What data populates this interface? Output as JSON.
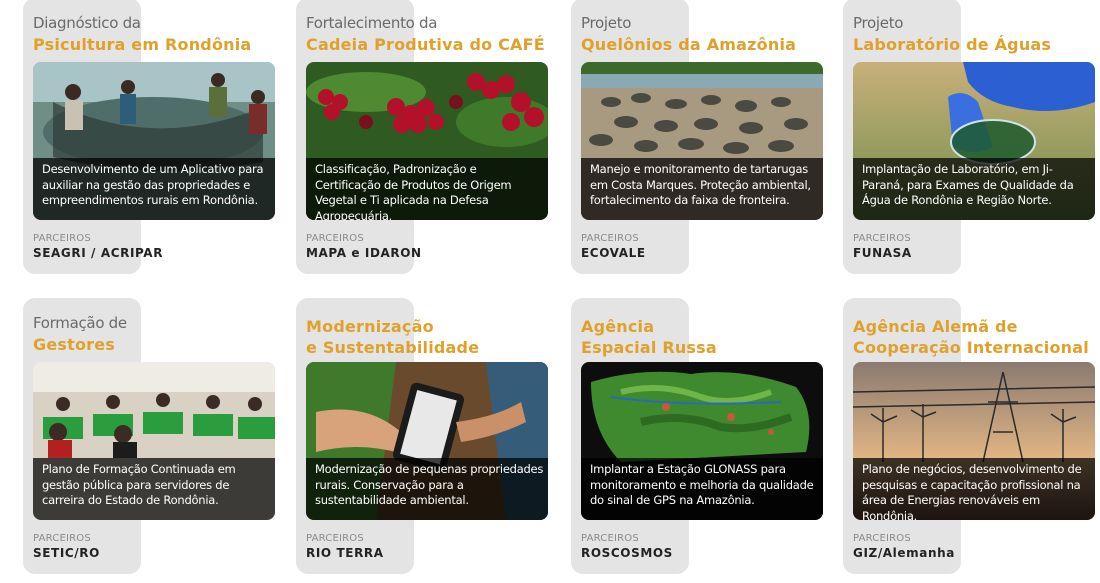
{
  "cards": [
    {
      "pre": "Diagnóstico da",
      "title": "Psicultura em Rondônia",
      "desc": "Desenvolvimento de um Aplicativo para auxiliar na gestão das propriedades e empreendimentos rurais em Rondônia.",
      "partners_label": "PARCEIROS",
      "partners": "SEAGRI / ACRIPAR"
    },
    {
      "pre": "Fortalecimento da",
      "title": "Cadeia Produtiva do CAFÉ",
      "desc": "Classificação, Padronização e Certificação de Produtos de Origem Vegetal e Ti aplicada na Defesa Agropecuária.",
      "partners_label": "PARCEIROS",
      "partners": "MAPA e IDARON"
    },
    {
      "pre": "Projeto",
      "title": "Quelônios da Amazônia",
      "desc": "Manejo e monitoramento de tartarugas em Costa Marques. Proteção ambiental, fortalecimento da faixa de fronteira.",
      "partners_label": "PARCEIROS",
      "partners": "ECOVALE"
    },
    {
      "pre": "Projeto",
      "title": "Laboratório de Águas",
      "desc": "Implantação de Laboratório, em Ji-Paraná, para Exames de Qualidade da Água de Rondônia e Região Norte.",
      "partners_label": "PARCEIROS",
      "partners": "FUNASA"
    },
    {
      "pre": "Formação de",
      "title": "Gestores",
      "desc": "Plano de Formação Continuada em gestão pública para servidores de carreira do Estado de Rondônia.",
      "partners_label": "PARCEIROS",
      "partners": "SETIC/RO"
    },
    {
      "title_line1": "Modernização",
      "title_line2": "e Sustentabilidade",
      "desc": "Modernização de pequenas propriedades rurais. Conservação para a sustentabilidade ambiental.",
      "partners_label": "PARCEIROS",
      "partners": "RIO TERRA"
    },
    {
      "title_line1": "Agência",
      "title_line2": "Espacial Russa",
      "desc": "Implantar a Estação GLONASS para monitoramento e melhoria da qualidade do sinal de GPS na Amazônia.",
      "partners_label": "PARCEIROS",
      "partners": "ROSCOSMOS"
    },
    {
      "title_line1": "Agência Alemã de",
      "title_line2": "Cooperação Internacional",
      "desc": "Plano de negócios, desenvolvimento de pesquisas e capacitação profissional na área de Energias renováveis em Rondônia.",
      "partners_label": "PARCEIROS",
      "partners": "GIZ/Alemanha"
    }
  ],
  "colors": {
    "title_accent": "#e0a12b",
    "tab_gray": "#e4e4e4",
    "overlay": "rgba(0,0,0,0.72)"
  },
  "image_subjects": [
    "fish-farming-net-photo",
    "coffee-berries-photo",
    "river-turtles-photo",
    "water-sample-lab-photo",
    "training-classroom-photo",
    "tablet-in-field-photo",
    "amazon-satellite-map-photo",
    "wind-turbines-power-lines-photo"
  ]
}
